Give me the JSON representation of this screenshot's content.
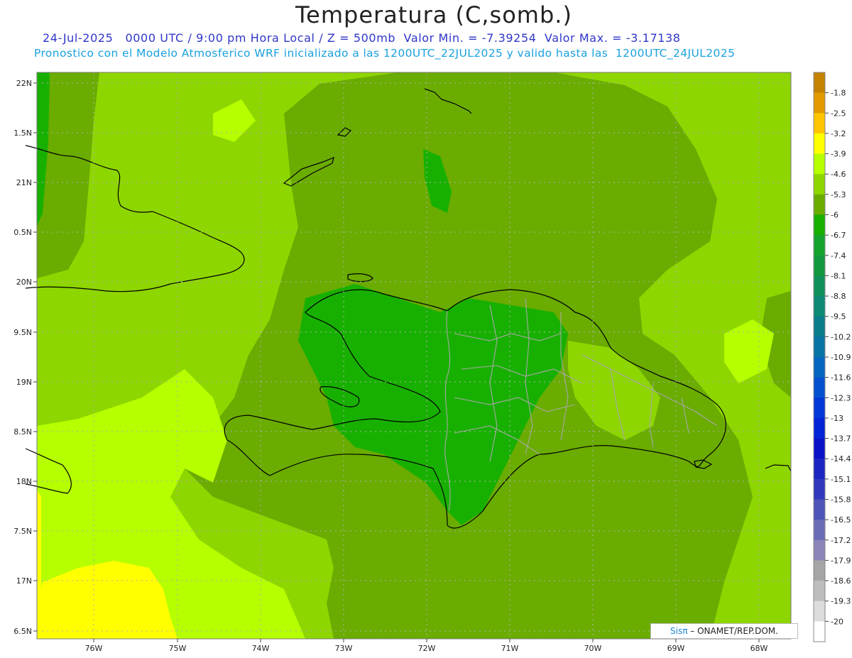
{
  "header": {
    "title": "Temperatura (C,somb.)",
    "subtitle_line1": "24-Jul-2025   0000 UTC / 9:00 pm Hora Local / Z = 500mb  Valor Min. = -7.39254  Valor Max. = -3.17138",
    "subtitle_line2": "Pronostico con el Modelo Atmosferico WRF inicializado a las 1200UTC_22JUL2025 y valido hasta las  1200UTC_24JUL2025"
  },
  "axes": {
    "x_ticks": [
      "76W",
      "75W",
      "74W",
      "73W",
      "72W",
      "71W",
      "70W",
      "69W",
      "68W"
    ],
    "y_ticks": [
      "22N",
      "1.5N",
      "21N",
      "0.5N",
      "20N",
      "9.5N",
      "19N",
      "8.5N",
      "18N",
      "7.5N",
      "17N",
      "6.5N"
    ],
    "lon_range": [
      -76.65,
      -67.6
    ],
    "lat_range": [
      16.45,
      22.1
    ],
    "grid": true
  },
  "colorbar": {
    "labels": [
      "-1.8",
      "-2.5",
      "-3.2",
      "-3.9",
      "-4.6",
      "-5.3",
      "-6",
      "-6.7",
      "-7.4",
      "-8.1",
      "-8.8",
      "-9.5",
      "-10.2",
      "-10.9",
      "-11.6",
      "-12.3",
      "-13",
      "-13.7",
      "-14.4",
      "-15.1",
      "-15.8",
      "-16.5",
      "-17.2",
      "-17.9",
      "-18.6",
      "-19.3",
      "-20"
    ],
    "colors": [
      "#c48200",
      "#e39a00",
      "#ffc400",
      "#ffff00",
      "#b5ff00",
      "#8ed600",
      "#6aac00",
      "#18b000",
      "#14a32c",
      "#12993f",
      "#10905a",
      "#0d8a74",
      "#0a7d8b",
      "#0874a4",
      "#0566bf",
      "#0351cf",
      "#0338d8",
      "#0323d6",
      "#0a12c8",
      "#1b26c2",
      "#3239bd",
      "#4d55b8",
      "#6b6cb6",
      "#8a84b9",
      "#a5a5a5",
      "#bdbdbd",
      "#dcdcdc",
      "#ffffff"
    ]
  },
  "map": {
    "field_colors": {
      "warm_yellow": "#ffff00",
      "light_green": "#b5ff00",
      "mid_green": "#8ed600",
      "olive_green": "#6aac00",
      "green": "#18b000",
      "coastline": "#000000",
      "provinces": "#a8a8a8"
    }
  },
  "watermark": {
    "logo": "Sisπ",
    "text": "– ONAMET/REP.DOM."
  }
}
